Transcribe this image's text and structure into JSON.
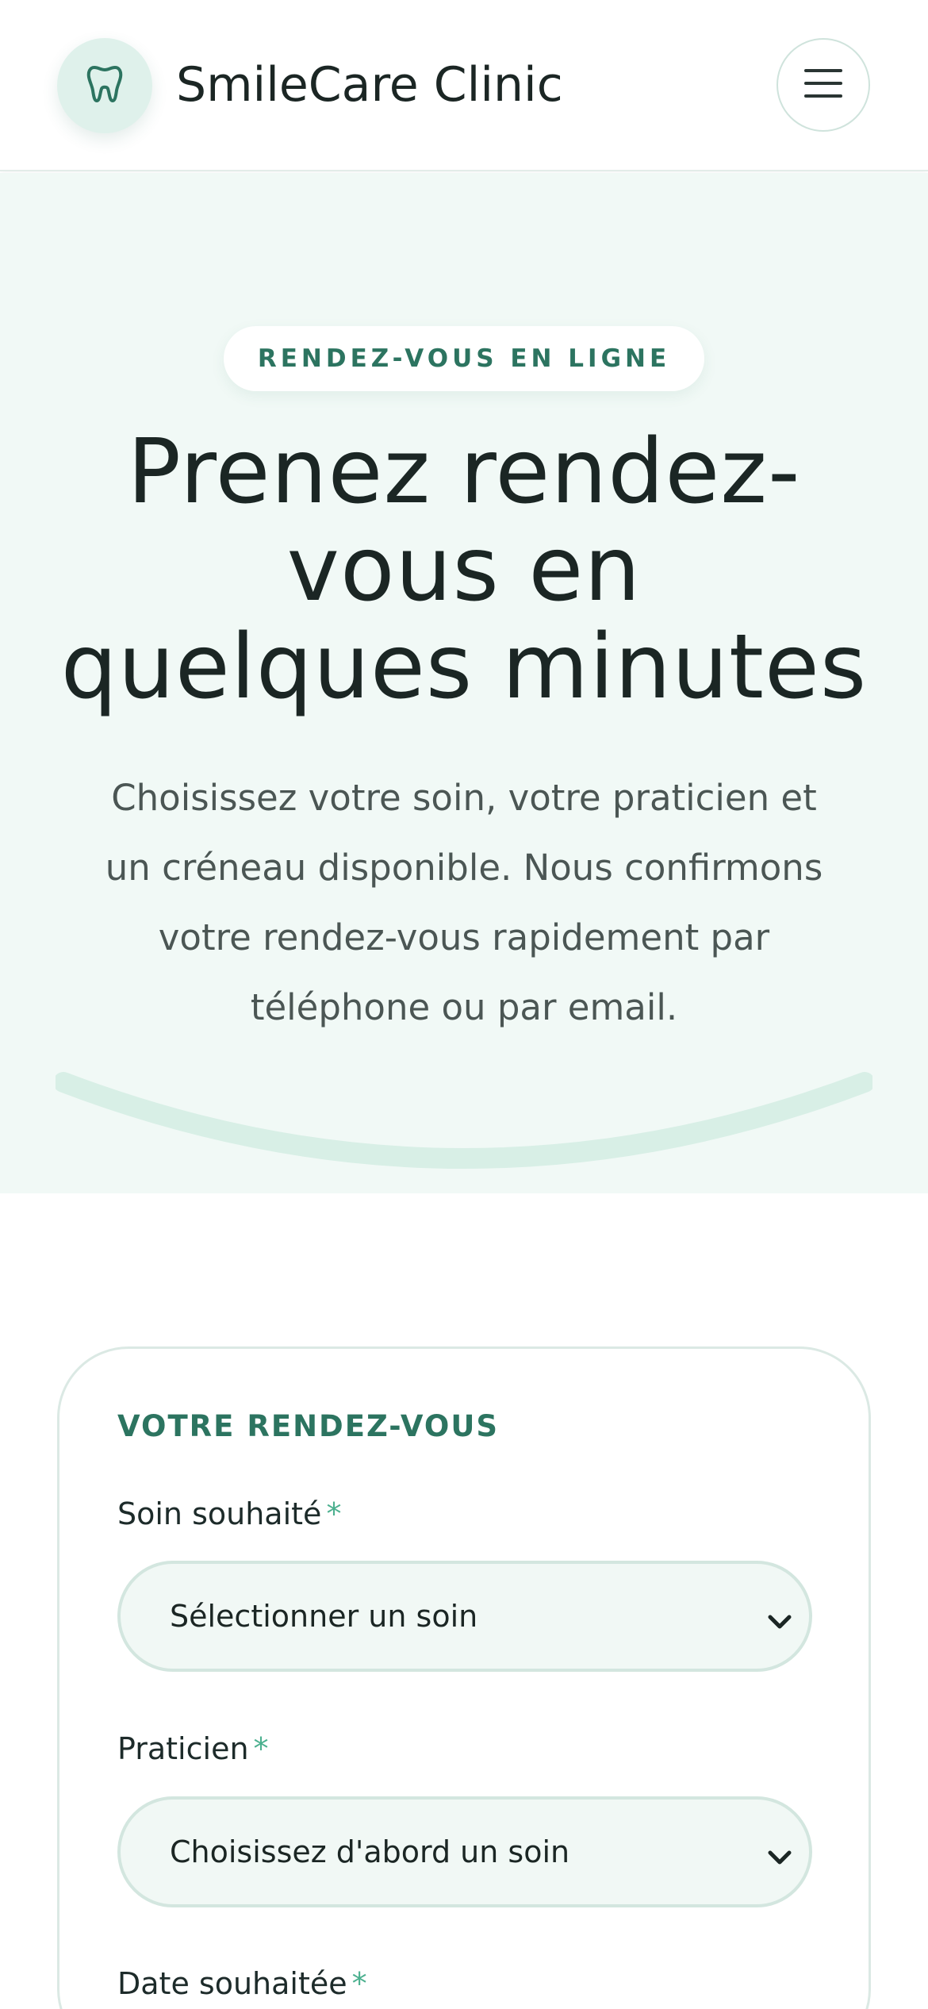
{
  "header": {
    "brand": "SmileCare Clinic",
    "logo_icon": "tooth-icon",
    "menu_icon": "hamburger-menu-icon"
  },
  "hero": {
    "eyebrow": "RENDEZ-VOUS EN LIGNE",
    "title_lines": [
      "Prenez rendez-",
      "vous en",
      "quelques minutes"
    ],
    "description_lines": [
      "Choisissez votre soin, votre praticien et",
      "un créneau disponible. Nous confirmons",
      "votre rendez-vous rapidement par",
      "téléphone ou par email."
    ]
  },
  "form": {
    "section_title": "VOTRE RENDEZ-VOUS",
    "required_mark": "*",
    "fields": [
      {
        "label": "Soin souhaité",
        "value": "Sélectionner un soin"
      },
      {
        "label": "Praticien",
        "value": "Choisissez d'abord un soin"
      },
      {
        "label": "Date souhaitée"
      }
    ]
  },
  "colors": {
    "accent": "#2c7460",
    "accent_light": "#dff1eb",
    "hero_bg": "#f1f9f6",
    "required": "#4cb08f"
  }
}
